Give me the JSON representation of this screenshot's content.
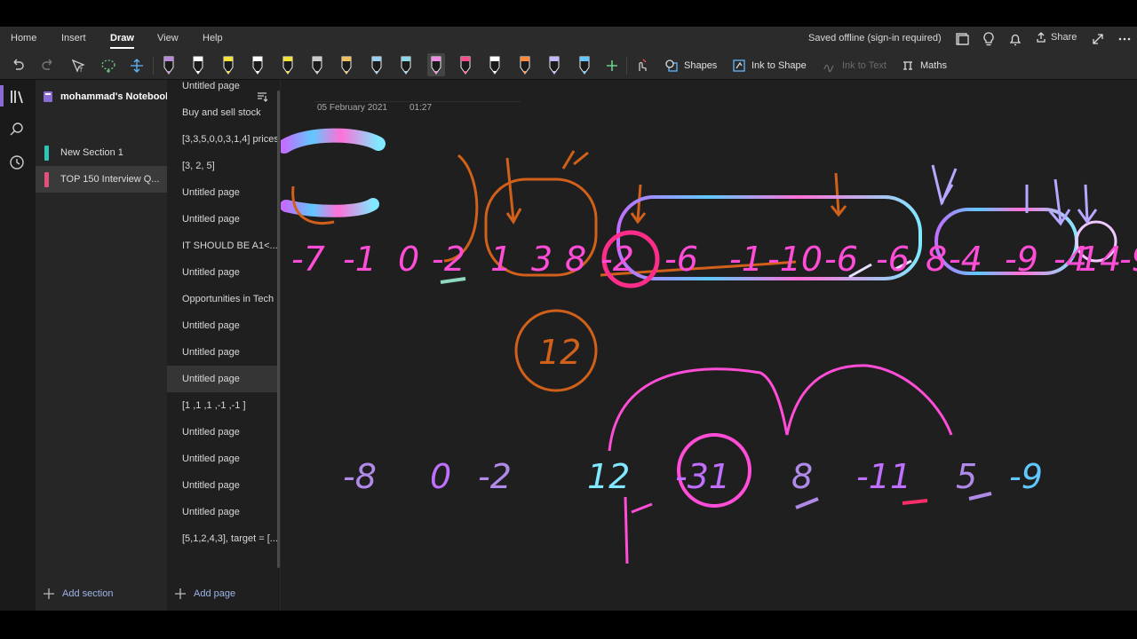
{
  "menu": {
    "tabs": [
      "Home",
      "Insert",
      "Draw",
      "View",
      "Help"
    ],
    "active_tab": "Draw",
    "status": "Saved offline (sign-in required)",
    "share_label": "Share"
  },
  "toolbar": {
    "shapes_label": "Shapes",
    "ink_to_shape_label": "Ink to Shape",
    "ink_to_text_label": "Ink to Text",
    "maths_label": "Maths",
    "pen_colors": [
      "#b98ad9",
      "#ffffff",
      "#f3e33a",
      "#ffffff",
      "#f3e33a",
      "#cccccc",
      "#f0c060",
      "#9ad0f0",
      "#8fd8e8",
      "#ef8be0",
      "#ff4d8d",
      "#ffffff",
      "#ff8a3d",
      "#c2b8ff",
      "#62c8ff"
    ]
  },
  "sections": {
    "notebook_title": "mohammad's Notebook",
    "items": [
      {
        "label": "New Section 1",
        "color": "#2ec4b6"
      },
      {
        "label": "TOP 150 Interview Q...",
        "color": "#e0507a"
      }
    ],
    "add_label": "Add section"
  },
  "pages": {
    "items": [
      "Untitled page",
      "Buy and sell stock",
      "[3,3,5,0,0,3,1,4] prices",
      "[3, 2, 5]",
      "Untitled page",
      "Untitled page",
      "IT SHOULD BE A1<...",
      "Untitled page",
      "Opportunities in Tech",
      "Untitled page",
      "Untitled page",
      "Untitled page",
      "[1 ,1 ,1 ,-1 ,-1 ]",
      "Untitled page",
      "Untitled page",
      "Untitled page",
      "Untitled page",
      "[5,1,2,4,3], target = [..."
    ],
    "active_index": 11,
    "add_label": "Add page"
  },
  "page": {
    "date": "05 February 2021",
    "time": "01:27"
  },
  "ink": {
    "row1": [
      "-7",
      "-1",
      "0",
      "-2",
      "1",
      "3",
      "8",
      "-2",
      "-6",
      "-1",
      "-10",
      "-6",
      "-6",
      "8",
      "-4",
      "-9",
      "-4",
      "14",
      "-9"
    ],
    "circled_sum": "12",
    "row2": [
      "-8",
      "0",
      "-2",
      "12",
      "-31",
      "8",
      "-11",
      "5",
      "-9"
    ]
  }
}
